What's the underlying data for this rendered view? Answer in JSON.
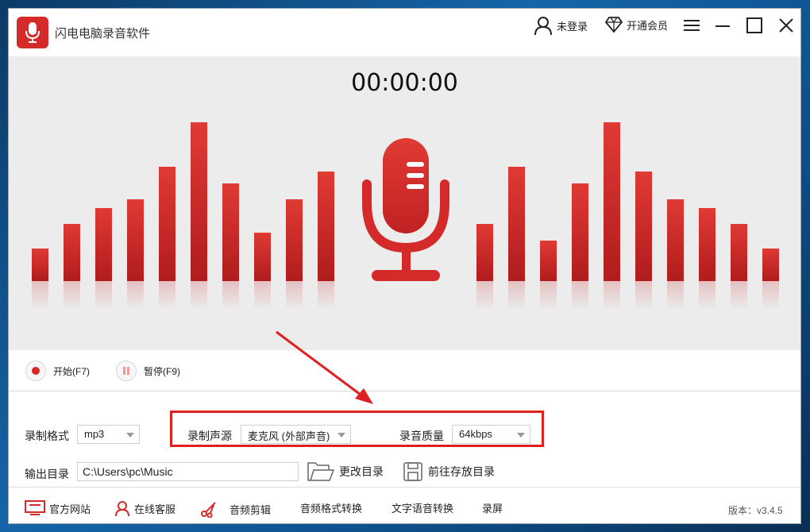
{
  "app": {
    "title": "闪电电脑录音软件"
  },
  "header": {
    "login_label": "未登录",
    "vip_label": "开通会员"
  },
  "recorder": {
    "timer": "00:00:00"
  },
  "controls": {
    "start_label": "开始(F7)",
    "pause_label": "暂停(F9)"
  },
  "settings": {
    "format_label": "录制格式",
    "format_value": "mp3",
    "source_label": "录制声源",
    "source_value": "麦克风 (外部声音)",
    "quality_label": "录音质量",
    "quality_value": "64kbps",
    "output_label": "输出目录",
    "output_value": "C:\\Users\\pc\\Music",
    "change_dir_label": "更改目录",
    "open_dir_label": "前往存放目录"
  },
  "footer": {
    "items": [
      {
        "label": "官方网站",
        "icon": "monitor-icon"
      },
      {
        "label": "在线客服",
        "icon": "person-icon"
      },
      {
        "label": "音频剪辑",
        "icon": "scissors-icon"
      },
      {
        "label": "音频格式转换"
      },
      {
        "label": "文字语音转换"
      },
      {
        "label": "录屏"
      }
    ],
    "version": "版本：v3.4.5"
  },
  "colors": {
    "accent": "#d42a2a",
    "highlight": "#e02020",
    "visual_bg": "#ececec"
  }
}
